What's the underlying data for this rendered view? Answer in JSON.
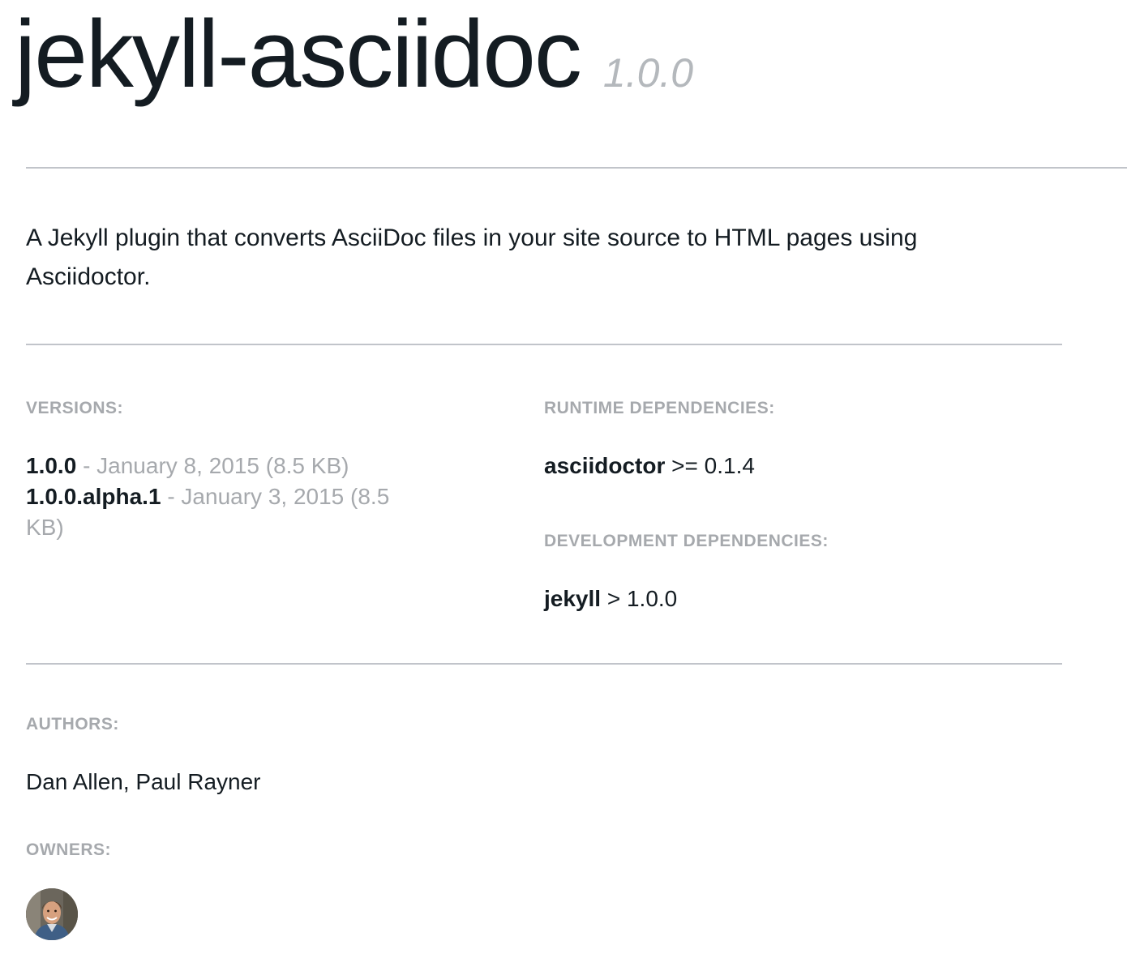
{
  "gem": {
    "name": "jekyll-asciidoc",
    "version": "1.0.0",
    "description": "A Jekyll plugin that converts AsciiDoc files in your site source to HTML pages using Asciidoctor."
  },
  "versions": {
    "heading": "VERSIONS:",
    "items": [
      {
        "number": "1.0.0",
        "meta": "- January 8, 2015 (8.5 KB)"
      },
      {
        "number": "1.0.0.alpha.1",
        "meta": "- January 3, 2015 (8.5 KB)"
      }
    ]
  },
  "runtime_dependencies": {
    "heading": "RUNTIME DEPENDENCIES:",
    "items": [
      {
        "name": "asciidoctor",
        "requirement": ">= 0.1.4"
      }
    ]
  },
  "development_dependencies": {
    "heading": "DEVELOPMENT DEPENDENCIES:",
    "items": [
      {
        "name": "jekyll",
        "requirement": "> 1.0.0"
      }
    ]
  },
  "authors": {
    "heading": "AUTHORS:",
    "names": "Dan Allen, Paul Rayner"
  },
  "owners": {
    "heading": "OWNERS:",
    "items": [
      {
        "icon": "owner-avatar"
      }
    ]
  },
  "colors": {
    "text": "#141c22",
    "muted": "#a6a9ad",
    "version_tag": "#b4b8bc",
    "rule": "#c1c4ca"
  }
}
